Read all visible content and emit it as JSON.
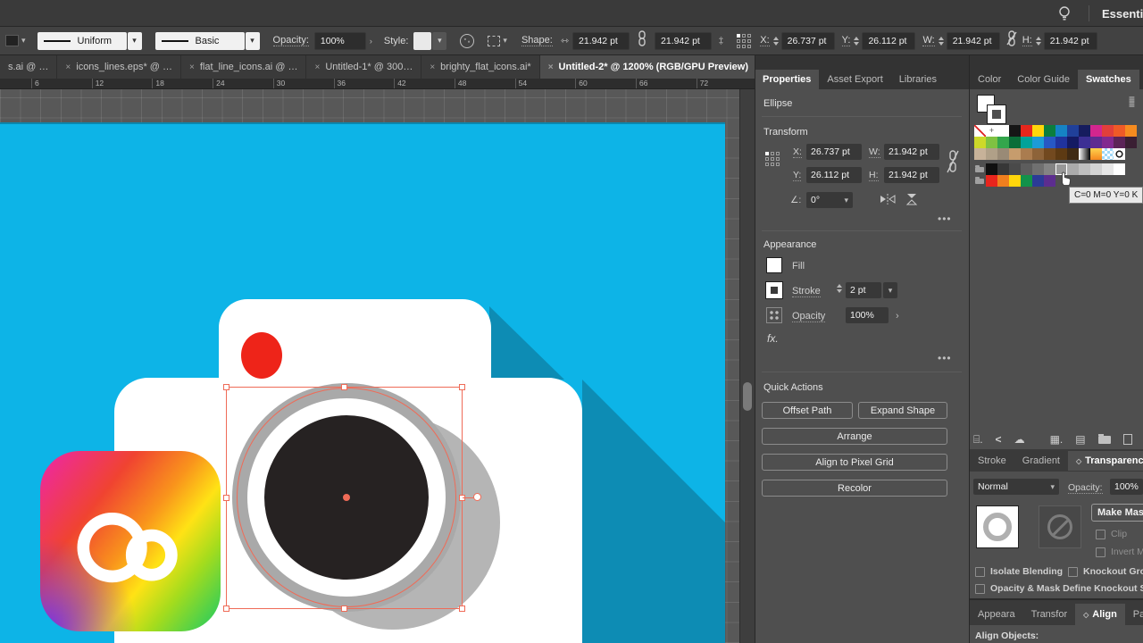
{
  "app": {
    "workspace_label": "Essenti"
  },
  "control_bar": {
    "stroke_profile": "Uniform",
    "brush": "Basic",
    "opacity_label": "Opacity:",
    "opacity_value": "100%",
    "style_label": "Style:",
    "shape_label": "Shape:",
    "shape_w": "21.942 pt",
    "shape_h": "21.942 pt",
    "x_label": "X:",
    "x_value": "26.737 pt",
    "y_label": "Y:",
    "y_value": "26.112 pt",
    "w_label": "W:",
    "w_value": "21.942 pt",
    "h_label": "H:",
    "h_value": "21.942 pt"
  },
  "doc_tabs": [
    {
      "label": "s.ai @ …",
      "close": false,
      "active": false
    },
    {
      "label": "icons_lines.eps* @ …",
      "close": true,
      "active": false
    },
    {
      "label": "flat_line_icons.ai @ …",
      "close": true,
      "active": false
    },
    {
      "label": "Untitled-1* @ 300…",
      "close": true,
      "active": false
    },
    {
      "label": "brighty_flat_icons.ai*",
      "close": true,
      "active": false
    },
    {
      "label": "Untitled-2* @ 1200% (RGB/GPU Preview)",
      "close": true,
      "active": true
    }
  ],
  "ruler": {
    "numbers": [
      6,
      12,
      18,
      24,
      30,
      36,
      42,
      48,
      54,
      60,
      66,
      72
    ]
  },
  "canvas": {
    "colors": {
      "canvas-bg": "#0db4e7",
      "long-shadow": "#0d8cb4",
      "camera-body": "#ffffff",
      "flash-red": "#ee2419",
      "lens-ring": "#a9a9a9",
      "lens-inner": "#262222",
      "lens-shadow": "#b5b5b5",
      "selection": "#ef6b57"
    }
  },
  "properties": {
    "tabs": [
      "Properties",
      "Asset Export",
      "Libraries"
    ],
    "object_type": "Ellipse",
    "transform": {
      "heading": "Transform",
      "x_label": "X:",
      "x_value": "26.737 pt",
      "y_label": "Y:",
      "y_value": "26.112 pt",
      "w_label": "W:",
      "w_value": "21.942 pt",
      "h_label": "H:",
      "h_value": "21.942 pt",
      "angle_value": "0°"
    },
    "appearance": {
      "heading": "Appearance",
      "fill_label": "Fill",
      "stroke_label": "Stroke",
      "stroke_weight": "2 pt",
      "opacity_label": "Opacity",
      "opacity_value": "100%",
      "fx_label": "fx."
    },
    "quick_actions": {
      "heading": "Quick Actions",
      "buttons": [
        "Offset Path",
        "Expand Shape",
        "Arrange",
        "Align to Pixel Grid",
        "Recolor"
      ]
    },
    "more_options": "•••"
  },
  "swatches": {
    "tabs": [
      "Color",
      "Color Guide",
      "Swatches"
    ],
    "rows": [
      [
        "none",
        "registration",
        "#ffffff",
        "#161616",
        "#e7271d",
        "#ffd60b",
        "#0b7e3e",
        "#1583c5",
        "#20409a",
        "#161c5e",
        "#d3268e",
        "#e23f3b",
        "#ef5a27",
        "#f68b1f"
      ],
      [
        "#cdd929",
        "#7fc242",
        "#33a64c",
        "#0a6e38",
        "#00a39a",
        "#1d9bd7",
        "#2758c4",
        "#20339d",
        "#141a63",
        "#3c2f94",
        "#5f2c91",
        "#822a8f",
        "#5c2458",
        "#3a1f33"
      ],
      [
        "#c7b299",
        "#b0a088",
        "#998a76",
        "#c69c6d",
        "#aa7c4f",
        "#8d6339",
        "#72491f",
        "#5d3a13",
        "#3f2a14",
        "gradient-bw",
        "gradient-orange",
        "pattern-blue",
        "pattern-dot"
      ],
      [
        "folder",
        "#101010",
        "#373737",
        "#4a4a4a",
        "#5d5d5d",
        "#707070",
        "#848484",
        "#989898",
        "#ababab",
        "#bfbfbf",
        "#d3d3d3",
        "#e7e7e7",
        "#ffffff"
      ],
      [
        "folder",
        "#e8251d",
        "#f07f1e",
        "#ffd60b",
        "#12924a",
        "#2b3b97",
        "#5c2d8f"
      ]
    ],
    "hover_cell": {
      "row": 3,
      "col": 7
    },
    "tooltip": "C=0 M=0 Y=0 K"
  },
  "transparency": {
    "tabs": [
      "Stroke",
      "Gradient",
      "Transparency"
    ],
    "blend_mode": "Normal",
    "opacity_label": "Opacity:",
    "opacity_value": "100%",
    "make_mask_label": "Make Mas",
    "clip_label": "Clip",
    "invert_label": "Invert Ma",
    "isolate_label": "Isolate Blending",
    "knockout_label": "Knockout Group",
    "opacity_mask_label": "Opacity & Mask Define Knockout Shap"
  },
  "bottom_panel": {
    "tabs": [
      "Appeara",
      "Transfor",
      "Align",
      "Pathfin"
    ],
    "align_objects_label": "Align Objects:"
  }
}
